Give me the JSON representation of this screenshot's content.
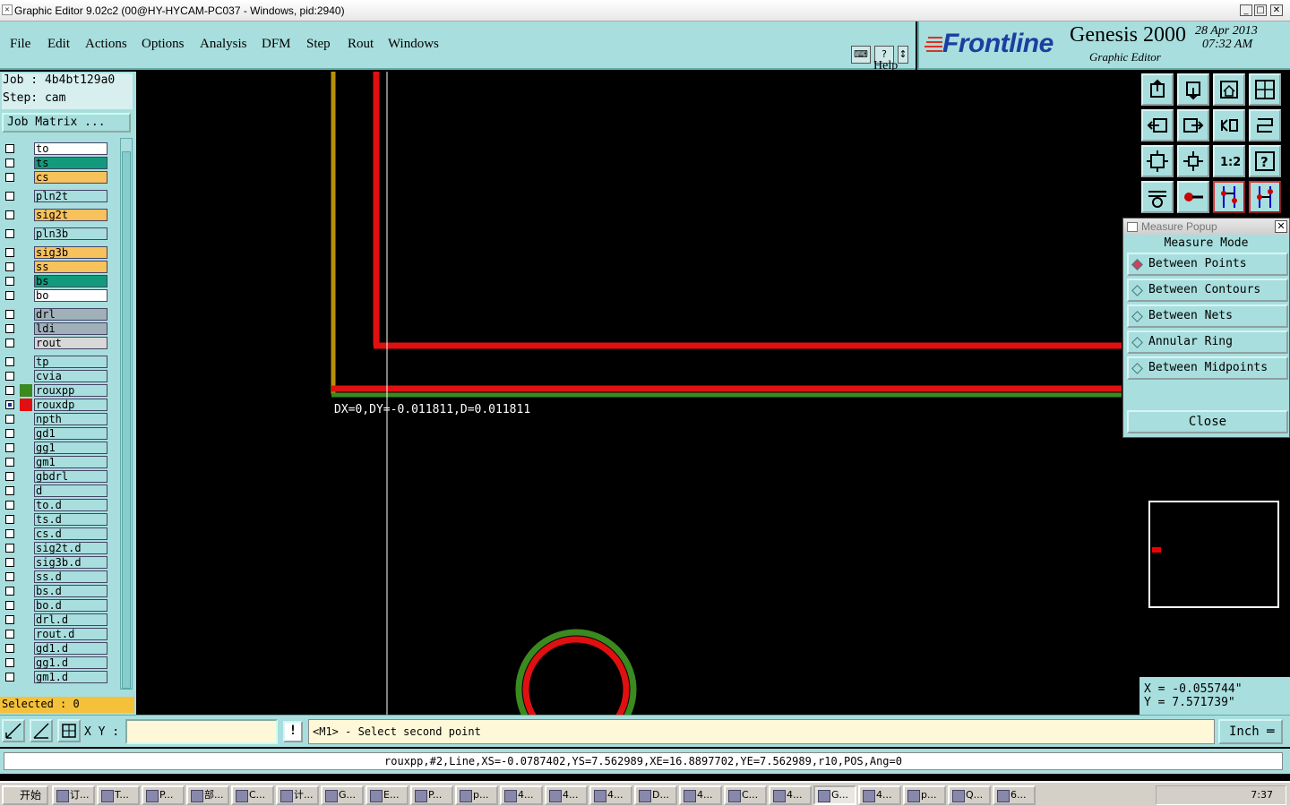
{
  "window": {
    "title": "Graphic Editor 9.02c2 (00@HY-HYCAM-PC037 - Windows, pid:2940)",
    "minimize": "_",
    "maximize": "□",
    "close": "✕"
  },
  "menu": [
    {
      "label": "File"
    },
    {
      "label": "Edit"
    },
    {
      "label": "Actions"
    },
    {
      "label": "Options"
    },
    {
      "label": "Analysis"
    },
    {
      "label": "DFM"
    },
    {
      "label": "Step"
    },
    {
      "label": "Rout"
    },
    {
      "label": "Windows"
    }
  ],
  "help_label": "Help",
  "branding": {
    "logo": "Frontline",
    "product": "Genesis 2000",
    "subtitle": "Graphic Editor",
    "date": "28 Apr 2013",
    "time": "07:32 AM"
  },
  "job": {
    "job_line": "Job : 4b4bt129a0",
    "step_line": "Step: cam",
    "matrix_button": "Job Matrix ..."
  },
  "layers": [
    {
      "name": "to",
      "color": "#ffffff",
      "checked": false,
      "gap": false
    },
    {
      "name": "ts",
      "color": "#139a7c",
      "checked": false,
      "gap": false
    },
    {
      "name": "cs",
      "color": "#f7c15c",
      "checked": false,
      "gap": false
    },
    {
      "name": "pln2t",
      "color": "#a8dede",
      "checked": false,
      "gap": true
    },
    {
      "name": "sig2t",
      "color": "#f7c15c",
      "checked": false,
      "gap": true
    },
    {
      "name": "pln3b",
      "color": "#a8dede",
      "checked": false,
      "gap": true
    },
    {
      "name": "sig3b",
      "color": "#f7c15c",
      "checked": false,
      "gap": true
    },
    {
      "name": "ss",
      "color": "#f7c15c",
      "checked": false,
      "gap": false
    },
    {
      "name": "bs",
      "color": "#139a7c",
      "checked": false,
      "gap": false
    },
    {
      "name": "bo",
      "color": "#ffffff",
      "checked": false,
      "gap": false
    },
    {
      "name": "drl",
      "color": "#9fb0b8",
      "checked": false,
      "gap": true
    },
    {
      "name": "ldi",
      "color": "#9fb0b8",
      "checked": false,
      "gap": false
    },
    {
      "name": "rout",
      "color": "#d8d8d8",
      "checked": false,
      "gap": false
    },
    {
      "name": "tp",
      "color": "#a8dede",
      "checked": false,
      "gap": true
    },
    {
      "name": "cvia",
      "color": "#a8dede",
      "checked": false,
      "gap": false
    },
    {
      "name": "rouxpp",
      "color": "#a8dede",
      "checked": false,
      "gap": false,
      "swatch": "#3a8a20"
    },
    {
      "name": "rouxdp",
      "color": "#a8dede",
      "checked": true,
      "gap": false,
      "swatch": "#e01010"
    },
    {
      "name": "npth",
      "color": "#a8dede",
      "checked": false,
      "gap": false
    },
    {
      "name": "gd1",
      "color": "#a8dede",
      "checked": false,
      "gap": false
    },
    {
      "name": "gg1",
      "color": "#a8dede",
      "checked": false,
      "gap": false
    },
    {
      "name": "gm1",
      "color": "#a8dede",
      "checked": false,
      "gap": false
    },
    {
      "name": "gbdrl",
      "color": "#a8dede",
      "checked": false,
      "gap": false
    },
    {
      "name": "d",
      "color": "#a8dede",
      "checked": false,
      "gap": false
    },
    {
      "name": "to.d",
      "color": "#a8dede",
      "checked": false,
      "gap": false
    },
    {
      "name": "ts.d",
      "color": "#a8dede",
      "checked": false,
      "gap": false
    },
    {
      "name": "cs.d",
      "color": "#a8dede",
      "checked": false,
      "gap": false
    },
    {
      "name": "sig2t.d",
      "color": "#a8dede",
      "checked": false,
      "gap": false
    },
    {
      "name": "sig3b.d",
      "color": "#a8dede",
      "checked": false,
      "gap": false
    },
    {
      "name": "ss.d",
      "color": "#a8dede",
      "checked": false,
      "gap": false
    },
    {
      "name": "bs.d",
      "color": "#a8dede",
      "checked": false,
      "gap": false
    },
    {
      "name": "bo.d",
      "color": "#a8dede",
      "checked": false,
      "gap": false
    },
    {
      "name": "drl.d",
      "color": "#a8dede",
      "checked": false,
      "gap": false
    },
    {
      "name": "rout.d",
      "color": "#a8dede",
      "checked": false,
      "gap": false
    },
    {
      "name": "gd1.d",
      "color": "#a8dede",
      "checked": false,
      "gap": false
    },
    {
      "name": "gg1.d",
      "color": "#a8dede",
      "checked": false,
      "gap": false
    },
    {
      "name": "gm1.d",
      "color": "#a8dede",
      "checked": false,
      "gap": false
    }
  ],
  "selected_text": "Selected : 0",
  "canvas": {
    "measure_text": "DX=0,DY=-0.011811,D=0.011811"
  },
  "measure_popup": {
    "title": "Measure Popup",
    "mode_label": "Measure Mode",
    "options": [
      {
        "label": "Between Points",
        "selected": true
      },
      {
        "label": "Between Contours",
        "selected": false
      },
      {
        "label": "Between Nets",
        "selected": false
      },
      {
        "label": "Annular Ring",
        "selected": false
      },
      {
        "label": "Between Midpoints",
        "selected": false
      }
    ],
    "close_label": "Close"
  },
  "coords": {
    "x": "X = -0.055744\"",
    "y": "Y = 7.571739\""
  },
  "bottom": {
    "xy_label": "X Y :",
    "xy_value": "",
    "warn": "!",
    "prompt": "<M1> - Select second point",
    "unit": "Inch"
  },
  "status_line": "rouxpp,#2,Line,XS=-0.0787402,YS=7.562989,XE=16.8897702,YE=7.562989,r10,POS,Ang=0",
  "taskbar": {
    "start": "开始",
    "items": [
      "订...",
      "T...",
      "P...",
      "部...",
      "C...",
      "计...",
      "G...",
      "E...",
      "P...",
      "p...",
      "4...",
      "4...",
      "4...",
      "D...",
      "4...",
      "C...",
      "4...",
      "G...",
      "4...",
      "p...",
      "Q...",
      "6..."
    ],
    "active_index": 17,
    "clock": "7:37"
  },
  "colors": {
    "panel": "#a8dede",
    "red_trace": "#e01010",
    "green_trace": "#3a8a20",
    "olive_trace": "#b89008",
    "highlight": "#f5c13a"
  }
}
